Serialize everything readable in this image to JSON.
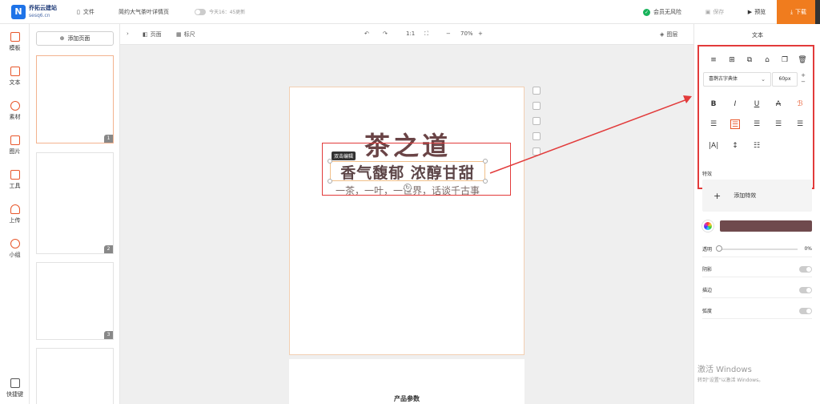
{
  "header": {
    "brand_name": "乔拓云建站",
    "brand_domain": "sesq6.cn",
    "file_label": "文件",
    "doc_title": "简约大气茶叶详情页",
    "autosave_text": "今天16：45更新",
    "member_status": "会员无风险",
    "save_label": "保存",
    "preview_label": "预览",
    "download_label": "下载"
  },
  "sidebar": {
    "items": [
      {
        "label": "模板"
      },
      {
        "label": "文本"
      },
      {
        "label": "素材"
      },
      {
        "label": "图片"
      },
      {
        "label": "工具"
      },
      {
        "label": "上传"
      },
      {
        "label": "小组"
      }
    ],
    "shortcut_label": "快捷键"
  },
  "pages_panel": {
    "add_page_label": "添加页面",
    "page_numbers": [
      "1",
      "2",
      "3"
    ]
  },
  "editor_toolbar": {
    "page_label": "页面",
    "ruler_label": "标尺",
    "ratio_label": "1:1",
    "zoom": "70%",
    "layers_label": "图层"
  },
  "canvas": {
    "title": "茶之道",
    "subtitle": "香气馥郁 浓醇甘甜",
    "line": "一茶，一叶，一世界，话谈千古事",
    "tooltip": "双击编辑",
    "next_page_title": "产品参数",
    "watermark": "激活 Windows"
  },
  "right_panel": {
    "header": "文本",
    "font_name": "喜鹊古字典体",
    "font_size": "60px",
    "effects_label": "特效",
    "add_effect_label": "添加特效",
    "text_color": "#6f4a4d",
    "opacity_label": "透明",
    "opacity_value": "0%",
    "shadow_label": "阴影",
    "stroke_label": "描边",
    "curve_label": "弧度",
    "watermark_title": "激活 Windows",
    "watermark_sub": "转到\"设置\"以激活 Windows。"
  }
}
